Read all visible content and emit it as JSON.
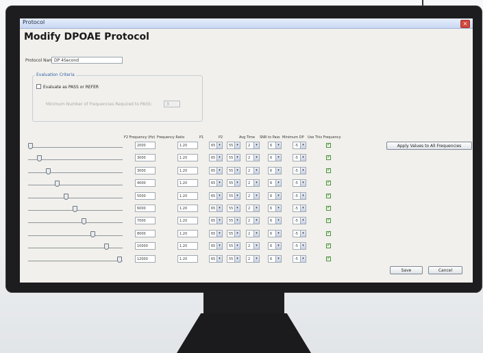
{
  "window": {
    "title": "Protocol",
    "close_symbol": "×"
  },
  "page": {
    "heading": "Modify DPOAE Protocol"
  },
  "protocol": {
    "name_label": "Protocol Name:",
    "name_value": "DP 4Second"
  },
  "criteria": {
    "group_title": "Evaluation Criteria",
    "evaluate_label": "Evaluate as PASS or REFER",
    "evaluate_checked": false,
    "min_freq_label": "Minimum Number of Frequencies Required to PASS:",
    "min_freq_value": "3"
  },
  "table": {
    "headers": [
      "F2 Frequency (Hz)",
      "Frequency Ratio",
      "P1",
      "P2",
      "Avg Time",
      "SNR to Pass",
      "Minimum DP",
      "Use This Frequency"
    ],
    "rows": [
      {
        "freq": "2000",
        "ratio": "1.20",
        "p1": "65",
        "p2": "55",
        "avg": "2",
        "snr": "6",
        "mindp": "-5",
        "use": true,
        "level": 0.0
      },
      {
        "freq": "3000",
        "ratio": "1.20",
        "p1": "65",
        "p2": "55",
        "avg": "2",
        "snr": "6",
        "mindp": "-5",
        "use": true,
        "level": 0.1
      },
      {
        "freq": "3000",
        "ratio": "1.20",
        "p1": "65",
        "p2": "55",
        "avg": "2",
        "snr": "6",
        "mindp": "-5",
        "use": true,
        "level": 0.2
      },
      {
        "freq": "4000",
        "ratio": "1.20",
        "p1": "65",
        "p2": "55",
        "avg": "2",
        "snr": "6",
        "mindp": "-5",
        "use": true,
        "level": 0.3
      },
      {
        "freq": "5000",
        "ratio": "1.20",
        "p1": "65",
        "p2": "55",
        "avg": "2",
        "snr": "6",
        "mindp": "-5",
        "use": true,
        "level": 0.4
      },
      {
        "freq": "6000",
        "ratio": "1.20",
        "p1": "65",
        "p2": "55",
        "avg": "2",
        "snr": "6",
        "mindp": "-5",
        "use": true,
        "level": 0.5
      },
      {
        "freq": "7000",
        "ratio": "1.20",
        "p1": "65",
        "p2": "55",
        "avg": "2",
        "snr": "6",
        "mindp": "-5",
        "use": true,
        "level": 0.6
      },
      {
        "freq": "8000",
        "ratio": "1.20",
        "p1": "65",
        "p2": "55",
        "avg": "2",
        "snr": "6",
        "mindp": "-5",
        "use": true,
        "level": 0.7
      },
      {
        "freq": "10000",
        "ratio": "1.20",
        "p1": "65",
        "p2": "55",
        "avg": "2",
        "snr": "6",
        "mindp": "-5",
        "use": true,
        "level": 0.85
      },
      {
        "freq": "12000",
        "ratio": "1.20",
        "p1": "65",
        "p2": "55",
        "avg": "2",
        "snr": "6",
        "mindp": "-5",
        "use": true,
        "level": 1.0
      }
    ]
  },
  "buttons": {
    "apply_all": "Apply Values to All Frequencies",
    "save": "Save",
    "cancel": "Cancel"
  },
  "icons": {
    "dropdown": "chevron-down-icon",
    "check": "check-icon",
    "slider": "slider-thumb-icon"
  }
}
